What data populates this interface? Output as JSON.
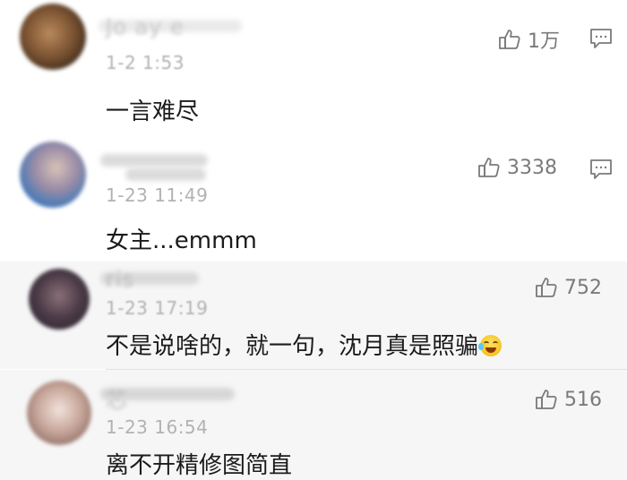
{
  "comments": [
    {
      "username": "Jo  ay  e",
      "timestamp": "1-2  1:53",
      "text": "一言难尽",
      "likes": "1万",
      "has_reply_icon": true
    },
    {
      "username": "",
      "timestamp": "1-23 11:49",
      "text": "女主...emmm",
      "likes": "3338",
      "has_reply_icon": true
    },
    {
      "username": "  ris",
      "timestamp": "1-23 17:19",
      "text": "不是说啥的，就一句，沈月真是照骗",
      "likes": "752",
      "has_reply_icon": false
    },
    {
      "username": "  芯",
      "timestamp": "1-23 16:54",
      "text": "离不开精修图简直",
      "likes": "516",
      "has_reply_icon": false
    }
  ],
  "icons": {
    "like": "thumbs-up-icon",
    "reply": "comment-bubble-icon",
    "emoji": "laughing-crying-emoji"
  },
  "colors": {
    "text": "#1b1b1b",
    "meta": "#b2b2b2",
    "likes": "#7a7a7a",
    "shaded_bg": "#f6f6f6"
  }
}
